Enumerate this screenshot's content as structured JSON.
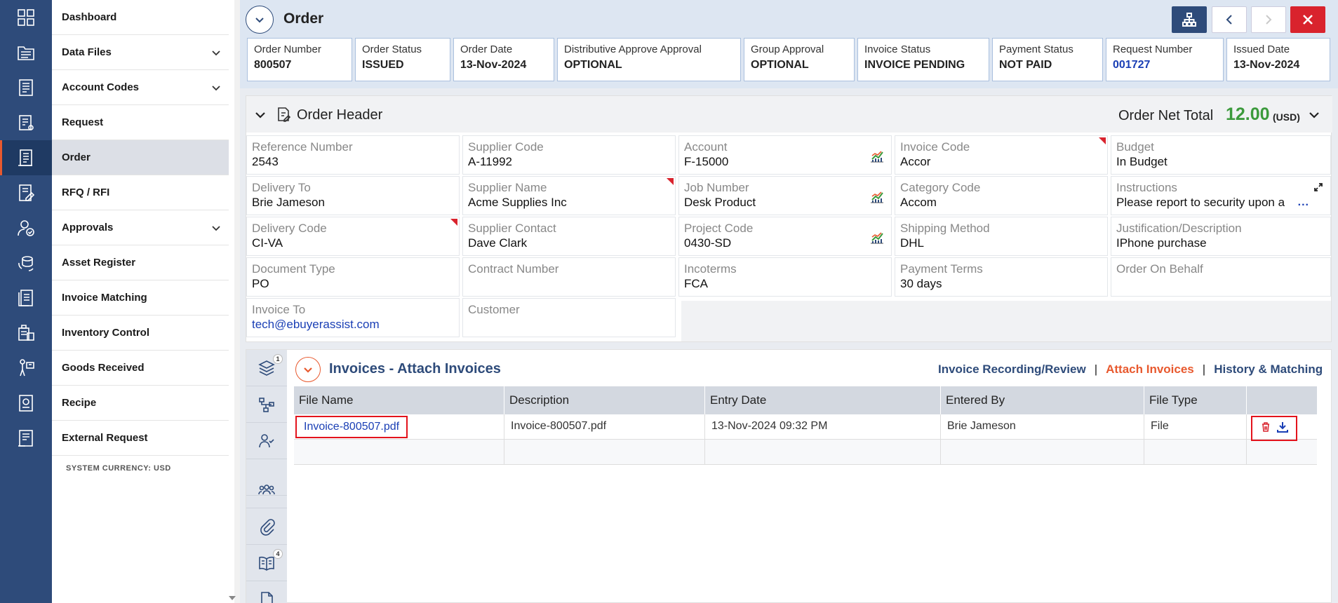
{
  "rail": {
    "icons": [
      "grid-icon",
      "data-files-icon",
      "account-codes-icon",
      "request-icon",
      "order-icon",
      "rfq-icon",
      "approvals-icon",
      "asset-register-icon",
      "invoice-matching-icon",
      "inventory-control-icon",
      "goods-received-icon",
      "recipe-icon",
      "external-request-icon"
    ]
  },
  "menu": {
    "items": [
      {
        "label": "Dashboard"
      },
      {
        "label": "Data Files"
      },
      {
        "label": "Account Codes"
      },
      {
        "label": "Request"
      },
      {
        "label": "Order"
      },
      {
        "label": "RFQ / RFI"
      },
      {
        "label": "Approvals"
      },
      {
        "label": "Asset Register"
      },
      {
        "label": "Invoice Matching"
      },
      {
        "label": "Inventory Control"
      },
      {
        "label": "Goods Received"
      },
      {
        "label": "Recipe"
      },
      {
        "label": "External Request"
      }
    ],
    "system_currency": "SYSTEM CURRENCY: USD"
  },
  "header": {
    "title": "Order",
    "stats": [
      {
        "label": "Order Number",
        "value": "800507"
      },
      {
        "label": "Order Status",
        "value": "ISSUED"
      },
      {
        "label": "Order Date",
        "value": "13-Nov-2024"
      },
      {
        "label": "Distributive Approve Approval",
        "value": "OPTIONAL"
      },
      {
        "label": "Group Approval",
        "value": "OPTIONAL"
      },
      {
        "label": "Invoice Status",
        "value": "INVOICE PENDING"
      },
      {
        "label": "Payment Status",
        "value": "NOT PAID"
      },
      {
        "label": "Request Number",
        "value": "001727"
      },
      {
        "label": "Issued Date",
        "value": "13-Nov-2024"
      }
    ]
  },
  "order_header": {
    "title": "Order Header",
    "total_label": "Order Net Total",
    "total_value": "12.00",
    "total_currency": "(USD)",
    "fields": [
      {
        "label": "Reference Number",
        "value": "2543"
      },
      {
        "label": "Supplier Code",
        "value": "A-11992"
      },
      {
        "label": "Account",
        "value": "F-15000"
      },
      {
        "label": "Invoice Code",
        "value": "Accor"
      },
      {
        "label": "Budget",
        "value": "In Budget"
      },
      {
        "label": "Delivery To",
        "value": "Brie Jameson"
      },
      {
        "label": "Supplier Name",
        "value": "Acme Supplies Inc"
      },
      {
        "label": "Job Number",
        "value": "Desk Product"
      },
      {
        "label": "Category Code",
        "value": "Accom"
      },
      {
        "label": "Instructions",
        "value": "Please report to security upon a"
      },
      {
        "label": "Delivery Code",
        "value": "CI-VA"
      },
      {
        "label": "Supplier Contact",
        "value": "Dave Clark"
      },
      {
        "label": "Project Code",
        "value": "0430-SD"
      },
      {
        "label": "Shipping Method",
        "value": "DHL"
      },
      {
        "label": "Justification/Description",
        "value": "IPhone purchase"
      },
      {
        "label": "Document Type",
        "value": "PO"
      },
      {
        "label": "Contract Number",
        "value": ""
      },
      {
        "label": "Incoterms",
        "value": "FCA"
      },
      {
        "label": "Payment Terms",
        "value": "30 days"
      },
      {
        "label": "Order On Behalf",
        "value": ""
      },
      {
        "label": "Invoice To",
        "value": "tech@ebuyerassist.com"
      },
      {
        "label": "Customer",
        "value": ""
      }
    ],
    "more_text": "..."
  },
  "invoices": {
    "title": "Invoices - Attach Invoices",
    "links": {
      "recording": "Invoice Recording/Review",
      "attach": "Attach Invoices",
      "history": "History & Matching",
      "separator": "|"
    },
    "tab_badges": {
      "layers": "1",
      "book": "4"
    },
    "columns": [
      "File Name",
      "Description",
      "Entry Date",
      "Entered By",
      "File Type",
      ""
    ],
    "rows": [
      {
        "file_name": "Invoice-800507.pdf",
        "description": "Invoice-800507.pdf",
        "entry_date": "13-Nov-2024 09:32 PM",
        "entered_by": "Brie Jameson",
        "file_type": "File"
      }
    ]
  },
  "colors": {
    "rail": "#2e4b7a",
    "accent_orange": "#e8592e",
    "total_green": "#3c9a3c",
    "danger_red": "#d9232d",
    "link_blue": "#1a3fb5"
  }
}
